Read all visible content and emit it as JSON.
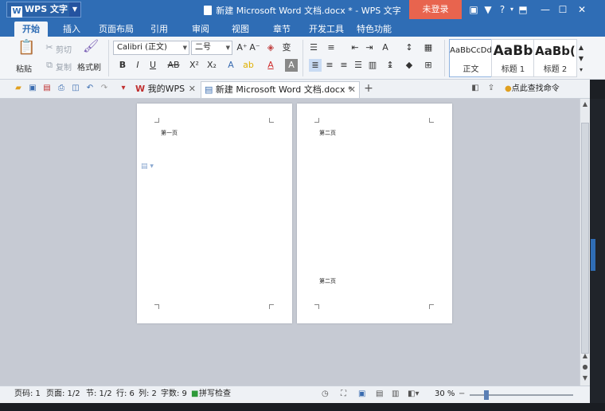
{
  "titlebar": {
    "app_label": "WPS 文字",
    "logo_glyph": "W",
    "doc_title": "新建 Microsoft Word 文档.docx * - WPS 文字",
    "login_label": "未登录",
    "help_label": "?"
  },
  "menu": {
    "tabs": [
      "开始",
      "插入",
      "页面布局",
      "引用",
      "审阅",
      "视图",
      "章节",
      "开发工具",
      "特色功能"
    ]
  },
  "ribbon": {
    "paste_label": "粘贴",
    "cut_label": "剪切",
    "copy_label": "复制",
    "format_painter_label": "格式刷",
    "font_name": "Calibri (正文)",
    "font_size": "二号",
    "bold": "B",
    "italic": "I",
    "underline": "U",
    "strikethrough": "AB",
    "superscript": "X²",
    "subscript": "X₂",
    "styles": [
      {
        "preview": "AaBbCcDd",
        "name": "正文"
      },
      {
        "preview": "AaBb",
        "name": "标题 1"
      },
      {
        "preview": "AaBb(",
        "name": "标题 2"
      }
    ]
  },
  "doc_tabs": {
    "my_wps": "我的WPS",
    "active_doc": "新建 Microsoft Word 文档.docx *",
    "add_tab": "+",
    "find_command": "点此查找命令 (Alt+Q)"
  },
  "pages": {
    "page1_text": "第一页",
    "page2_top_text": "第二页",
    "page2_bottom_text": "第二页"
  },
  "status": {
    "page_num": "页码: 1",
    "pages": "页面: 1/2",
    "section": "节: 1/2",
    "row": "行: 6",
    "col": "列: 2",
    "words": "字数: 9",
    "spellcheck": "拼写检查",
    "zoom": "30 %"
  },
  "colors": {
    "title_blue": "#2f6db5",
    "login_red": "#e8644e",
    "workspace_gray": "#c6cad3"
  }
}
